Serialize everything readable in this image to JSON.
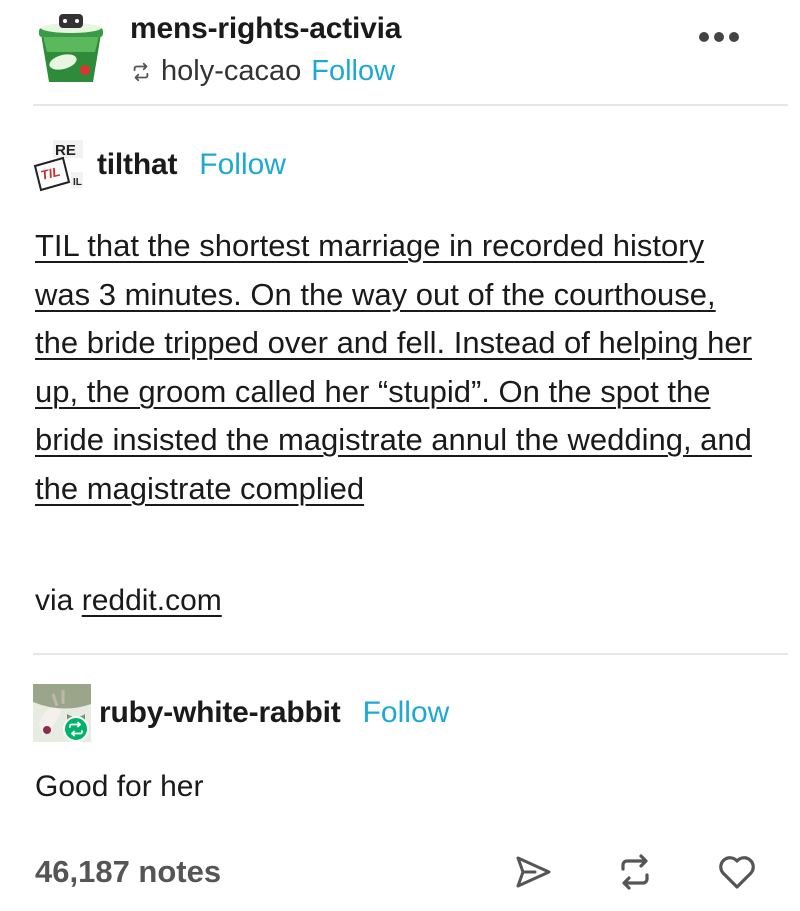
{
  "post": {
    "blog_name": "mens-rights-activia",
    "reblogged_from": "holy-cacao",
    "follow_label": "Follow"
  },
  "trail": [
    {
      "name": "tilthat",
      "follow_label": "Follow",
      "text": "TIL that the shortest marriage in recorded history was 3 minutes. On the way out of the courthouse, the bride tripped over and fell. Instead of helping her up, the groom called her “stupid”. On the spot the bride insisted the magistrate annul the wedding, and the magistrate complied",
      "via_label": "via",
      "via_link": "reddit.com"
    },
    {
      "name": "ruby-white-rabbit",
      "follow_label": "Follow",
      "text": "Good for her"
    }
  ],
  "footer": {
    "notes": "46,187 notes"
  },
  "icons": {
    "reblog": "reblog-icon",
    "more": "more-options-icon",
    "share": "share-icon",
    "like": "heart-icon"
  },
  "colors": {
    "follow": "#1ea8d8",
    "reblog_badge": "#00b36b"
  }
}
